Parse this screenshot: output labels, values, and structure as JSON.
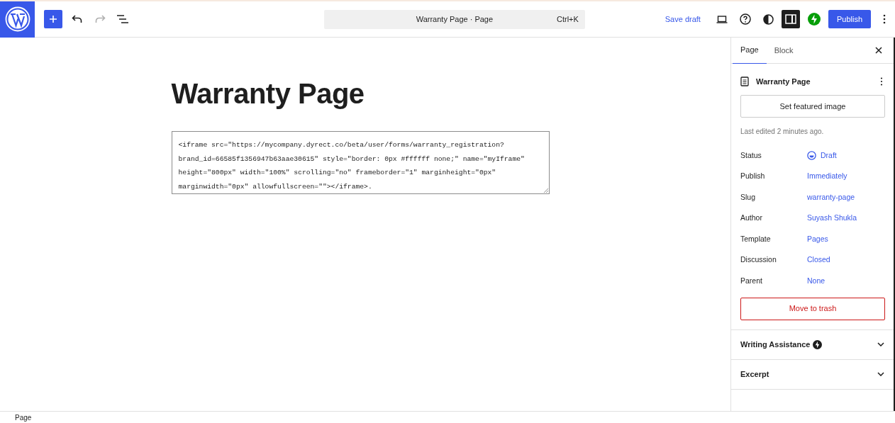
{
  "toolbar": {
    "command_bar": "Warranty Page · Page",
    "shortcut": "Ctrl+K",
    "save_draft": "Save draft",
    "publish": "Publish",
    "settings_panel_on": true,
    "redo_disabled": true
  },
  "editor": {
    "title": "Warranty Page",
    "code_lines": [
      "<iframe src=\"https://mycompany.dyrect.co/beta/user/forms/warranty_registration?",
      "brand_id=66585f1356947b63aae30615\" style=\"border: 0px #ffffff none;\" name=\"myIframe\"",
      "height=\"800px\" width=\"100%\" scrolling=\"no\" frameborder=\"1\" marginheight=\"0px\"",
      "marginwidth=\"0px\" allowfullscreen=\"\"></iframe>."
    ]
  },
  "sidebar": {
    "tabs": [
      {
        "label": "Page",
        "selected": true
      },
      {
        "label": "Block",
        "selected": false
      }
    ],
    "page_title": "Warranty Page",
    "featured_image": "Set featured image",
    "last_edited": "Last edited 2 minutes ago.",
    "fields": [
      {
        "label": "Status",
        "value": "Draft",
        "kind": "status"
      },
      {
        "label": "Publish",
        "value": "Immediately",
        "kind": "link"
      },
      {
        "label": "Slug",
        "value": "warranty-page",
        "kind": "link"
      },
      {
        "label": "Author",
        "value": "Suyash Shukla",
        "kind": "link"
      },
      {
        "label": "Template",
        "value": "Pages",
        "kind": "link"
      },
      {
        "label": "Discussion",
        "value": "Closed",
        "kind": "link"
      },
      {
        "label": "Parent",
        "value": "None",
        "kind": "link"
      }
    ],
    "trash": "Move to trash",
    "panels": [
      {
        "title": "Writing Assistance",
        "badge": true,
        "expanded": false
      },
      {
        "title": "Excerpt",
        "badge": false,
        "expanded": false
      }
    ]
  },
  "status_bar": "Page"
}
